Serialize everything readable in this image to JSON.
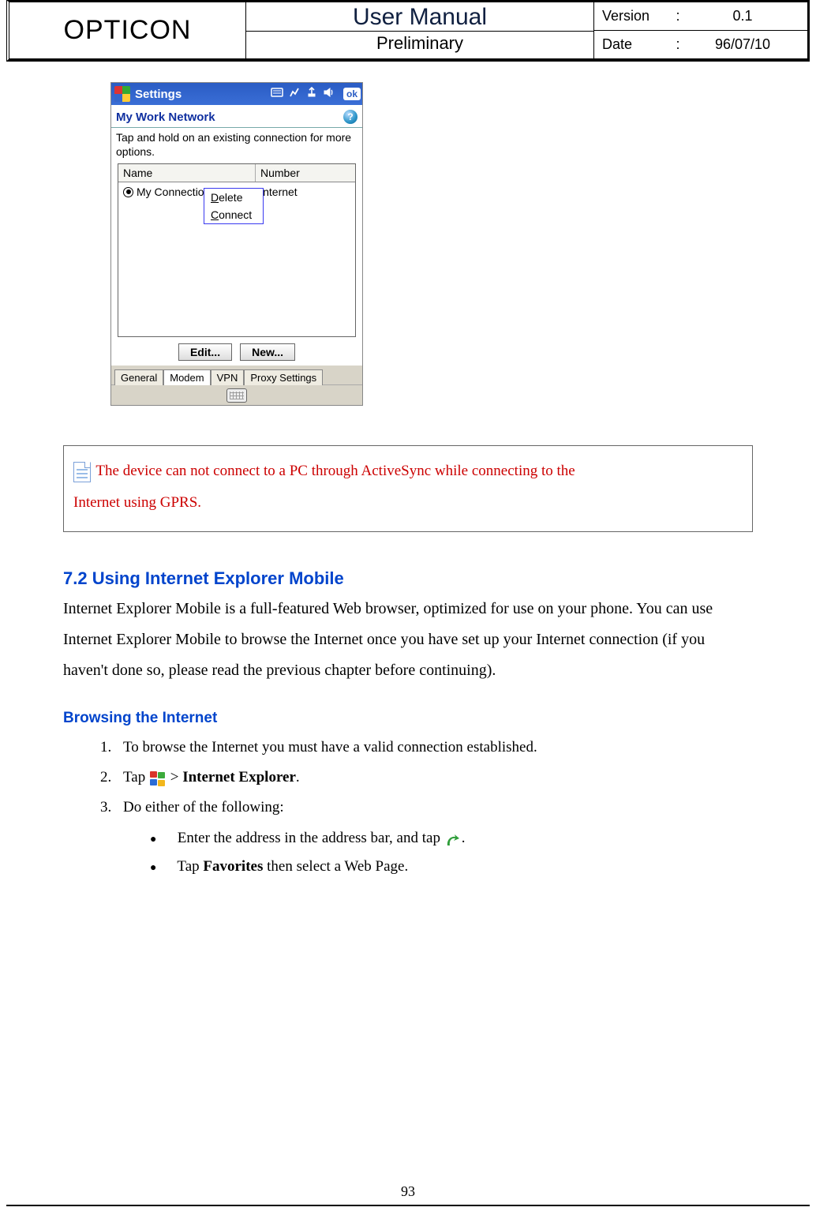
{
  "header": {
    "brand": "OPTICON",
    "title": "User Manual",
    "subtitle": "Preliminary",
    "meta": {
      "version_label": "Version",
      "version_value": "0.1",
      "date_label": "Date",
      "date_value": "96/07/10",
      "colon": ":"
    }
  },
  "wm": {
    "titlebar": "Settings",
    "ok": "ok",
    "subhead": "My Work Network",
    "help": "?",
    "instruction": "Tap and hold on an existing connection for more options.",
    "columns": {
      "name": "Name",
      "number": "Number"
    },
    "row": {
      "name": "My Connection",
      "number": "internet"
    },
    "context": {
      "delete_u": "D",
      "delete_rest": "elete",
      "connect_u": "C",
      "connect_rest": "onnect"
    },
    "buttons": {
      "edit": "Edit...",
      "new": "New..."
    },
    "tabs": [
      "General",
      "Modem",
      "VPN",
      "Proxy Settings"
    ],
    "active_tab_index": 1
  },
  "note": {
    "text1": " The device can not connect to a PC through ActiveSync while connecting to the ",
    "text2": "Internet using GPRS."
  },
  "section72": {
    "heading": "7.2 Using Internet Explorer Mobile",
    "para": "Internet Explorer Mobile is a full-featured Web browser, optimized for use on your phone. You can use Internet Explorer Mobile to browse the Internet once you have set up your Internet connection (if you haven't done so, please read the previous chapter before continuing)."
  },
  "browsing": {
    "heading": "Browsing the Internet",
    "step1": "To browse the Internet you must have a valid connection established.",
    "step2_a": "Tap ",
    "step2_b": " > ",
    "step2_c": "Internet Explorer",
    "step2_d": ".",
    "step3": "Do either of the following:",
    "bullet1_a": "Enter the address in the address bar, and tap ",
    "bullet1_b": ".",
    "bullet2_a": "Tap ",
    "bullet2_b": "Favorites",
    "bullet2_c": " then select a Web Page."
  },
  "page_number": "93"
}
